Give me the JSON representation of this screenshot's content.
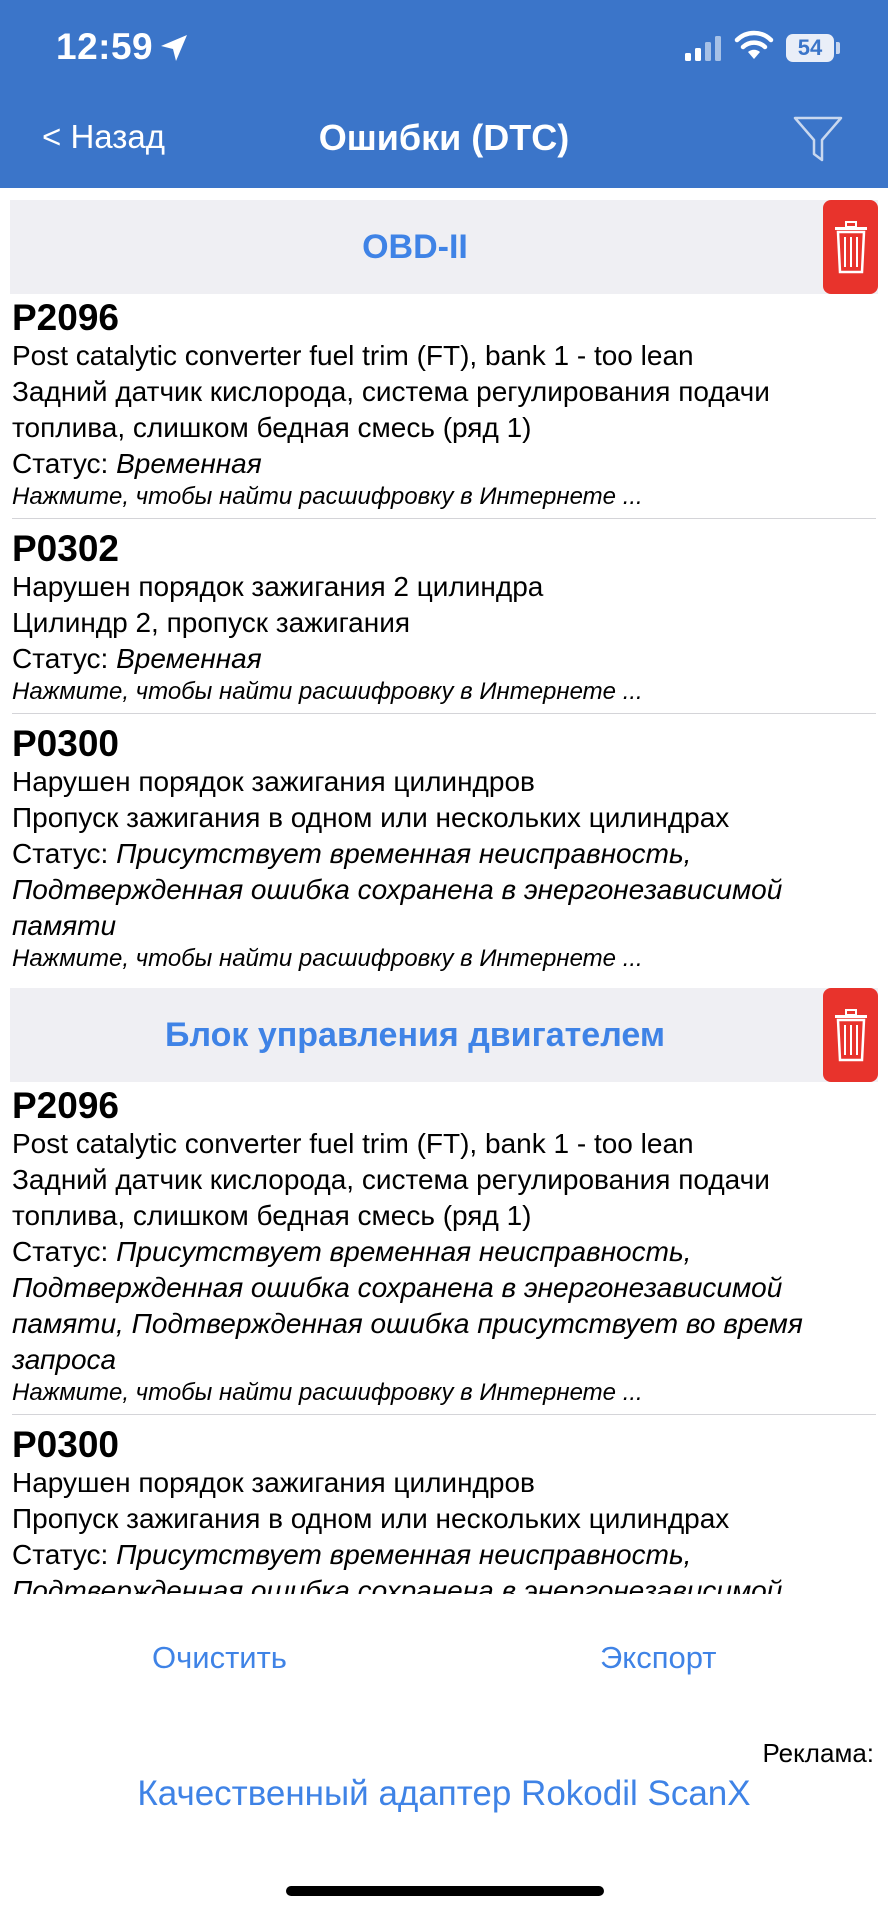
{
  "status_bar": {
    "time": "12:59",
    "battery": "54"
  },
  "nav": {
    "back_label": "< Назад",
    "title": "Ошибки (DTC)",
    "filter_icon": "filter-icon"
  },
  "colors": {
    "header_bg": "#3b75c9",
    "accent": "#3f83e6",
    "danger": "#e8332c",
    "section_bg": "#efeff3"
  },
  "sections": [
    {
      "title": "OBD-II",
      "items": [
        {
          "code": "P2096",
          "lines": [
            "Post catalytic converter fuel trim (FT), bank 1 - too lean",
            "Задний датчик кислорода, система регулирования подачи топлива, слишком бедная смесь (ряд 1)"
          ],
          "status_label": "Статус:",
          "status_value": "Временная",
          "hint": "Нажмите, чтобы найти расшифровку в Интернете ..."
        },
        {
          "code": "P0302",
          "lines": [
            "Нарушен порядок зажигания 2 цилиндра",
            "Цилиндр 2, пропуск зажигания"
          ],
          "status_label": "Статус:",
          "status_value": "Временная",
          "hint": "Нажмите, чтобы найти расшифровку в Интернете ..."
        },
        {
          "code": "P0300",
          "lines": [
            "Нарушен порядок зажигания цилиндров",
            "Пропуск зажигания в одном или нескольких цилиндрах"
          ],
          "status_label": "Статус:",
          "status_value": "Присутствует временная неисправность, Подтвержденная ошибка сохранена в энергонезависимой памяти",
          "hint": "Нажмите, чтобы найти расшифровку в Интернете ..."
        }
      ]
    },
    {
      "title": "Блок управления двигателем",
      "items": [
        {
          "code": "P2096",
          "lines": [
            "Post catalytic converter fuel trim (FT), bank 1 - too lean",
            "Задний датчик кислорода, система регулирования подачи топлива, слишком бедная смесь (ряд 1)"
          ],
          "status_label": "Статус:",
          "status_value": "Присутствует временная неисправность, Подтвержденная ошибка сохранена в энергонезависимой памяти, Подтвержденная ошибка присутствует во время запроса",
          "hint": "Нажмите, чтобы найти расшифровку в Интернете ..."
        },
        {
          "code": "P0300",
          "lines": [
            "Нарушен порядок зажигания цилиндров",
            "Пропуск зажигания в одном или нескольких цилиндрах"
          ],
          "status_label": "Статус:",
          "status_value": "Присутствует временная неисправность, Подтвержденная ошибка сохранена в энергонезависимой",
          "hint": ""
        }
      ]
    }
  ],
  "actions": {
    "clear": "Очистить",
    "export": "Экспорт"
  },
  "ad": {
    "label": "Реклама:",
    "link": "Качественный адаптер Rokodil ScanX"
  }
}
